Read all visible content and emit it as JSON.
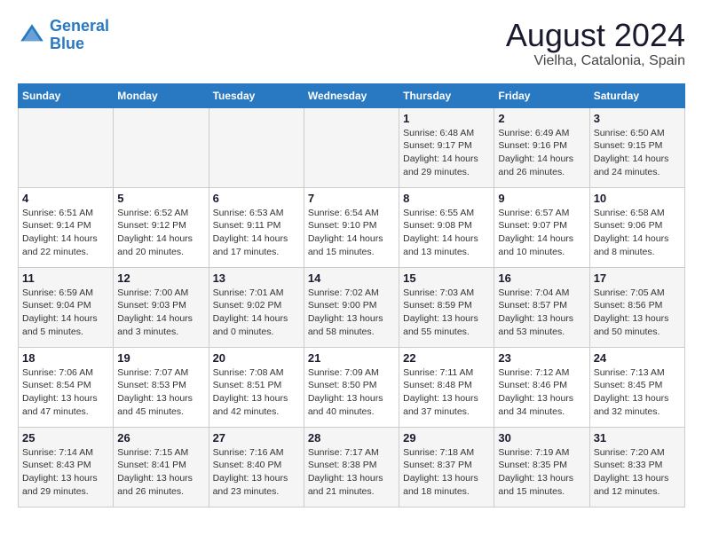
{
  "header": {
    "logo_line1": "General",
    "logo_line2": "Blue",
    "month_year": "August 2024",
    "location": "Vielha, Catalonia, Spain"
  },
  "weekdays": [
    "Sunday",
    "Monday",
    "Tuesday",
    "Wednesday",
    "Thursday",
    "Friday",
    "Saturday"
  ],
  "weeks": [
    [
      {
        "day": "",
        "info": ""
      },
      {
        "day": "",
        "info": ""
      },
      {
        "day": "",
        "info": ""
      },
      {
        "day": "",
        "info": ""
      },
      {
        "day": "1",
        "info": "Sunrise: 6:48 AM\nSunset: 9:17 PM\nDaylight: 14 hours\nand 29 minutes."
      },
      {
        "day": "2",
        "info": "Sunrise: 6:49 AM\nSunset: 9:16 PM\nDaylight: 14 hours\nand 26 minutes."
      },
      {
        "day": "3",
        "info": "Sunrise: 6:50 AM\nSunset: 9:15 PM\nDaylight: 14 hours\nand 24 minutes."
      }
    ],
    [
      {
        "day": "4",
        "info": "Sunrise: 6:51 AM\nSunset: 9:14 PM\nDaylight: 14 hours\nand 22 minutes."
      },
      {
        "day": "5",
        "info": "Sunrise: 6:52 AM\nSunset: 9:12 PM\nDaylight: 14 hours\nand 20 minutes."
      },
      {
        "day": "6",
        "info": "Sunrise: 6:53 AM\nSunset: 9:11 PM\nDaylight: 14 hours\nand 17 minutes."
      },
      {
        "day": "7",
        "info": "Sunrise: 6:54 AM\nSunset: 9:10 PM\nDaylight: 14 hours\nand 15 minutes."
      },
      {
        "day": "8",
        "info": "Sunrise: 6:55 AM\nSunset: 9:08 PM\nDaylight: 14 hours\nand 13 minutes."
      },
      {
        "day": "9",
        "info": "Sunrise: 6:57 AM\nSunset: 9:07 PM\nDaylight: 14 hours\nand 10 minutes."
      },
      {
        "day": "10",
        "info": "Sunrise: 6:58 AM\nSunset: 9:06 PM\nDaylight: 14 hours\nand 8 minutes."
      }
    ],
    [
      {
        "day": "11",
        "info": "Sunrise: 6:59 AM\nSunset: 9:04 PM\nDaylight: 14 hours\nand 5 minutes."
      },
      {
        "day": "12",
        "info": "Sunrise: 7:00 AM\nSunset: 9:03 PM\nDaylight: 14 hours\nand 3 minutes."
      },
      {
        "day": "13",
        "info": "Sunrise: 7:01 AM\nSunset: 9:02 PM\nDaylight: 14 hours\nand 0 minutes."
      },
      {
        "day": "14",
        "info": "Sunrise: 7:02 AM\nSunset: 9:00 PM\nDaylight: 13 hours\nand 58 minutes."
      },
      {
        "day": "15",
        "info": "Sunrise: 7:03 AM\nSunset: 8:59 PM\nDaylight: 13 hours\nand 55 minutes."
      },
      {
        "day": "16",
        "info": "Sunrise: 7:04 AM\nSunset: 8:57 PM\nDaylight: 13 hours\nand 53 minutes."
      },
      {
        "day": "17",
        "info": "Sunrise: 7:05 AM\nSunset: 8:56 PM\nDaylight: 13 hours\nand 50 minutes."
      }
    ],
    [
      {
        "day": "18",
        "info": "Sunrise: 7:06 AM\nSunset: 8:54 PM\nDaylight: 13 hours\nand 47 minutes."
      },
      {
        "day": "19",
        "info": "Sunrise: 7:07 AM\nSunset: 8:53 PM\nDaylight: 13 hours\nand 45 minutes."
      },
      {
        "day": "20",
        "info": "Sunrise: 7:08 AM\nSunset: 8:51 PM\nDaylight: 13 hours\nand 42 minutes."
      },
      {
        "day": "21",
        "info": "Sunrise: 7:09 AM\nSunset: 8:50 PM\nDaylight: 13 hours\nand 40 minutes."
      },
      {
        "day": "22",
        "info": "Sunrise: 7:11 AM\nSunset: 8:48 PM\nDaylight: 13 hours\nand 37 minutes."
      },
      {
        "day": "23",
        "info": "Sunrise: 7:12 AM\nSunset: 8:46 PM\nDaylight: 13 hours\nand 34 minutes."
      },
      {
        "day": "24",
        "info": "Sunrise: 7:13 AM\nSunset: 8:45 PM\nDaylight: 13 hours\nand 32 minutes."
      }
    ],
    [
      {
        "day": "25",
        "info": "Sunrise: 7:14 AM\nSunset: 8:43 PM\nDaylight: 13 hours\nand 29 minutes."
      },
      {
        "day": "26",
        "info": "Sunrise: 7:15 AM\nSunset: 8:41 PM\nDaylight: 13 hours\nand 26 minutes."
      },
      {
        "day": "27",
        "info": "Sunrise: 7:16 AM\nSunset: 8:40 PM\nDaylight: 13 hours\nand 23 minutes."
      },
      {
        "day": "28",
        "info": "Sunrise: 7:17 AM\nSunset: 8:38 PM\nDaylight: 13 hours\nand 21 minutes."
      },
      {
        "day": "29",
        "info": "Sunrise: 7:18 AM\nSunset: 8:37 PM\nDaylight: 13 hours\nand 18 minutes."
      },
      {
        "day": "30",
        "info": "Sunrise: 7:19 AM\nSunset: 8:35 PM\nDaylight: 13 hours\nand 15 minutes."
      },
      {
        "day": "31",
        "info": "Sunrise: 7:20 AM\nSunset: 8:33 PM\nDaylight: 13 hours\nand 12 minutes."
      }
    ]
  ]
}
